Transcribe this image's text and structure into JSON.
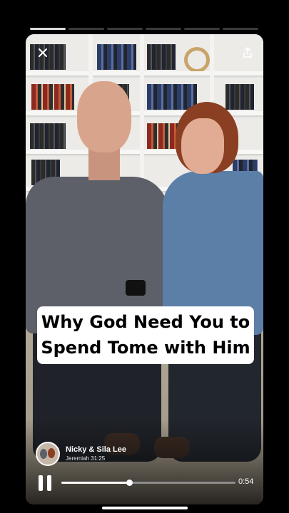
{
  "stories": {
    "count": 6,
    "active_index": 0
  },
  "video": {
    "caption_lines": [
      "Why God Need You to",
      "Spend Tome with Him"
    ]
  },
  "channel": {
    "name": "Nicky & Sila Lee",
    "subtitle": "Jeremiah 31:25"
  },
  "player": {
    "elapsed_fraction": 0.39,
    "time_label": "0:54",
    "state": "playing"
  },
  "icons": {
    "close": "close-icon",
    "share": "share-icon",
    "pause": "pause-icon"
  },
  "colors": {
    "background": "#000000",
    "caption_bg": "#ffffff",
    "caption_text": "#000000",
    "progress_active": "#d9d9d9",
    "progress_inactive": "#3a3a3a"
  }
}
